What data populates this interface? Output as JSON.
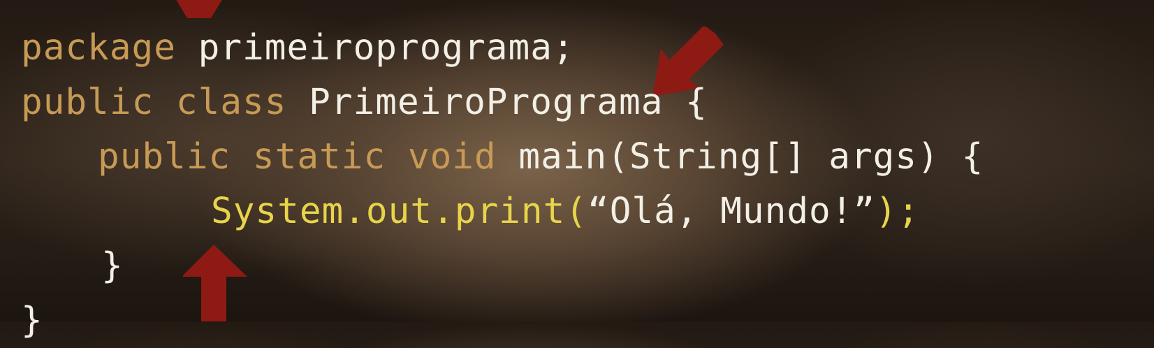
{
  "code": {
    "line1": {
      "kw": "package",
      "rest": " primeiroprograma;"
    },
    "line2": {
      "kw": "public class",
      "name": " PrimeiroPrograma",
      "brace": " {"
    },
    "line3": {
      "kw": "public static void",
      "rest": " main(String[] args) {"
    },
    "line4": {
      "sys_open": "System.out.print(",
      "text": "“Olá, Mundo!”",
      "sys_close": ");"
    },
    "line5": {
      "brace": "}"
    },
    "line6": {
      "brace": "}"
    }
  },
  "colors": {
    "keyword": "#c79a55",
    "identifier": "#f2efe6",
    "system_call": "#e8d44a",
    "arrow": "#8e1a14"
  },
  "annotations": [
    "arrow-pointing-down",
    "arrow-pointing-down-left",
    "arrow-pointing-up"
  ]
}
